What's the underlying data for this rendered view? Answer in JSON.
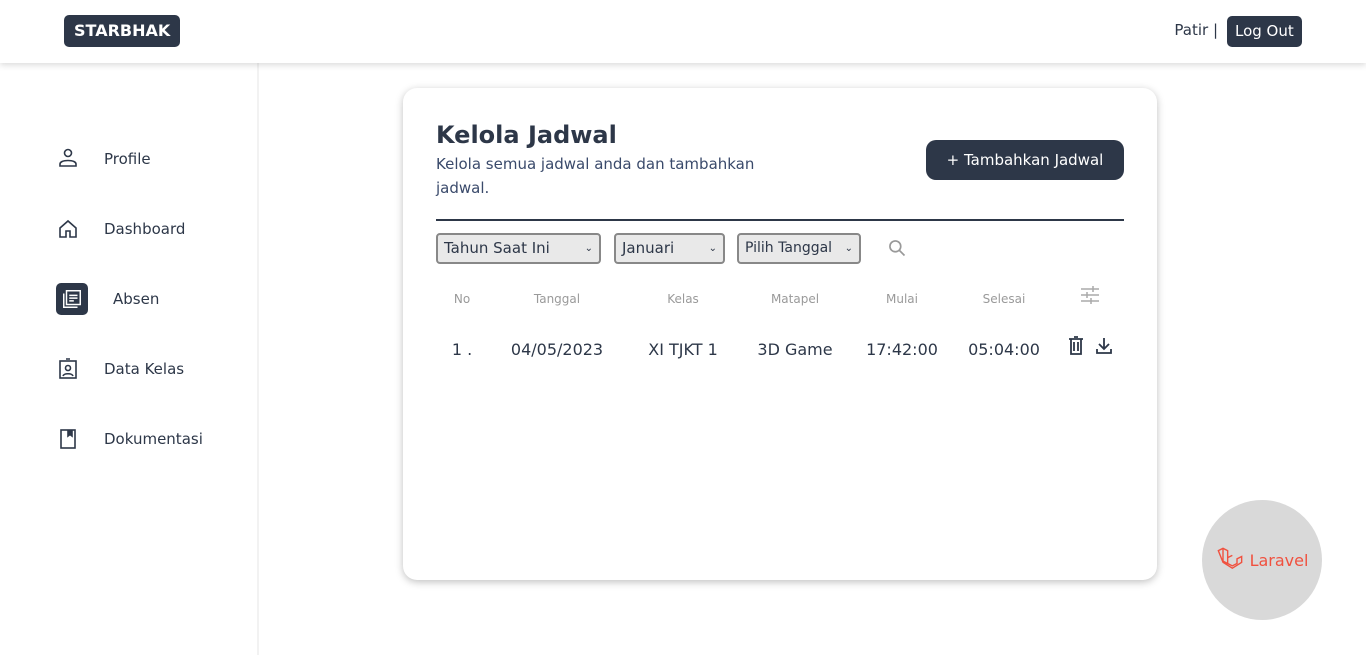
{
  "header": {
    "brand": "STARBHAK",
    "user": "Patir |",
    "logout": "Log Out"
  },
  "sidebar": {
    "items": [
      {
        "label": "Profile",
        "icon": "user-icon"
      },
      {
        "label": "Dashboard",
        "icon": "home-icon"
      },
      {
        "label": "Absen",
        "icon": "document-icon",
        "active": true
      },
      {
        "label": "Data Kelas",
        "icon": "badge-icon"
      },
      {
        "label": "Dokumentasi",
        "icon": "bookmark-icon"
      }
    ]
  },
  "main": {
    "title": "Kelola Jadwal",
    "subtitle": "Kelola semua jadwal anda dan tambahkan jadwal.",
    "add_button": "+ Tambahkan Jadwal",
    "filters": {
      "year": "Tahun Saat Ini",
      "month": "Januari",
      "date": "Pilih Tanggal"
    },
    "table": {
      "headers": [
        "No",
        "Tanggal",
        "Kelas",
        "Matapel",
        "Mulai",
        "Selesai"
      ],
      "rows": [
        [
          "1 .",
          "04/05/2023",
          "XI TJKT 1",
          "3D Game",
          "17:42:00",
          "05:04:00"
        ]
      ]
    }
  },
  "badge": {
    "label": "Laravel"
  },
  "colors": {
    "primary": "#2d3748",
    "laravel": "#f0513f"
  }
}
